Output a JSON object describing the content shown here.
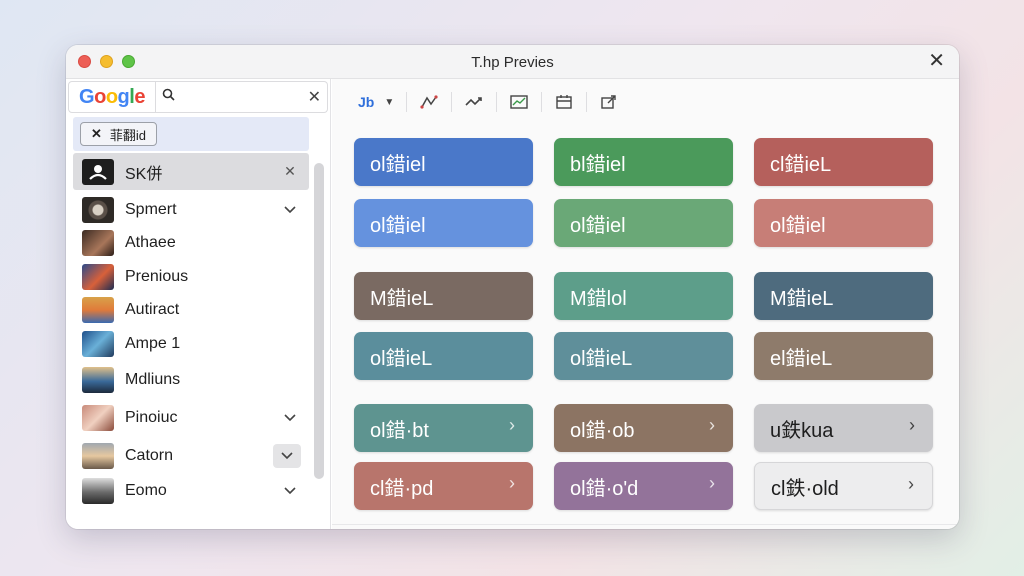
{
  "window": {
    "title": "T.hp Previes"
  },
  "search": {
    "logo": "Google",
    "value": ""
  },
  "chip": {
    "label": "菲翻id"
  },
  "sidebar": {
    "items": [
      {
        "label": "SK併",
        "right": "close",
        "selected": true
      },
      {
        "label": "Spmert",
        "right": "chevron"
      },
      {
        "label": "Athaee",
        "right": ""
      },
      {
        "label": "Prenious",
        "right": ""
      },
      {
        "label": "Autiract",
        "right": ""
      },
      {
        "label": "Ampe 1",
        "right": ""
      },
      {
        "label": "Mdliuns",
        "right": ""
      },
      {
        "label": "Pinoiuc",
        "right": "chevron"
      },
      {
        "label": "Catorn",
        "right": "chevron-boxed"
      },
      {
        "label": "Eomo",
        "right": "chevron"
      }
    ]
  },
  "toolbar": {
    "first_label": "Jb",
    "icons": [
      "hierarchy-icon",
      "trend-icon",
      "chart-icon",
      "calendar-icon",
      "export-icon"
    ]
  },
  "tiles": [
    {
      "label": "ol錯iel",
      "color": "#4a78c9",
      "chevron": false
    },
    {
      "label": "bl錯iel",
      "color": "#4b9a5b",
      "chevron": false
    },
    {
      "label": "cl錯ieL",
      "color": "#b5605c",
      "chevron": false
    },
    {
      "label": "ol錯iel",
      "color": "#6592de",
      "chevron": false
    },
    {
      "label": "ol錯iel",
      "color": "#6aa877",
      "chevron": false
    },
    {
      "label": "ol錯iel",
      "color": "#c77e77",
      "chevron": false
    },
    {
      "label": "M錯ieL",
      "color": "#7a6a62",
      "chevron": false
    },
    {
      "label": "M錯lol",
      "color": "#5d9e8a",
      "chevron": false
    },
    {
      "label": "M錯ieL",
      "color": "#4e6b7e",
      "chevron": false
    },
    {
      "label": "ol錯ieL",
      "color": "#5b8e9c",
      "chevron": false
    },
    {
      "label": "ol錯ieL",
      "color": "#5f8f9a",
      "chevron": false
    },
    {
      "label": "el錯ieL",
      "color": "#8e7b6b",
      "chevron": false
    },
    {
      "label": "ol錯·bt",
      "color": "#5e9490",
      "chevron": true
    },
    {
      "label": "ol錯·ob",
      "color": "#8c7463",
      "chevron": true
    },
    {
      "label": "u鉄kua",
      "color": "#c9c9cc",
      "chevron": true,
      "light": true
    },
    {
      "label": "cl錯·pd",
      "color": "#b8756c",
      "chevron": true
    },
    {
      "label": "ol錯·o'd",
      "color": "#93739a",
      "chevron": true
    },
    {
      "label": "cl鉄·old",
      "color": "#ededee",
      "chevron": true,
      "light": true
    }
  ]
}
